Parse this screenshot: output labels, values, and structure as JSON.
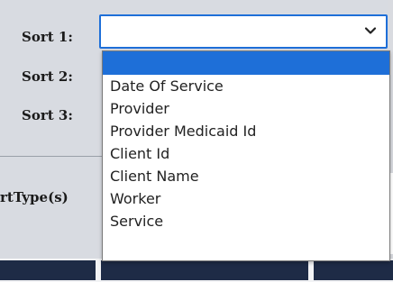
{
  "form": {
    "sort1_label": "Sort 1:",
    "sort2_label": "Sort 2:",
    "sort3_label": "Sort 3:",
    "sort_type_label": "rtType(s)",
    "sort1_selected_value": ""
  },
  "dropdown": {
    "items": [
      {
        "label": "",
        "selected": true
      },
      {
        "label": "Date Of Service",
        "selected": false
      },
      {
        "label": "Provider",
        "selected": false
      },
      {
        "label": "Provider Medicaid Id",
        "selected": false
      },
      {
        "label": "Client Id",
        "selected": false
      },
      {
        "label": "Client Name",
        "selected": false
      },
      {
        "label": "Worker",
        "selected": false
      },
      {
        "label": "Service",
        "selected": false
      }
    ]
  },
  "icons": {
    "select_chevron": "chevron-down-icon"
  },
  "colors": {
    "accent": "#1e6fd8",
    "panel_bg": "#d8dbe1",
    "bottom_button_bg": "#1e2b46"
  }
}
